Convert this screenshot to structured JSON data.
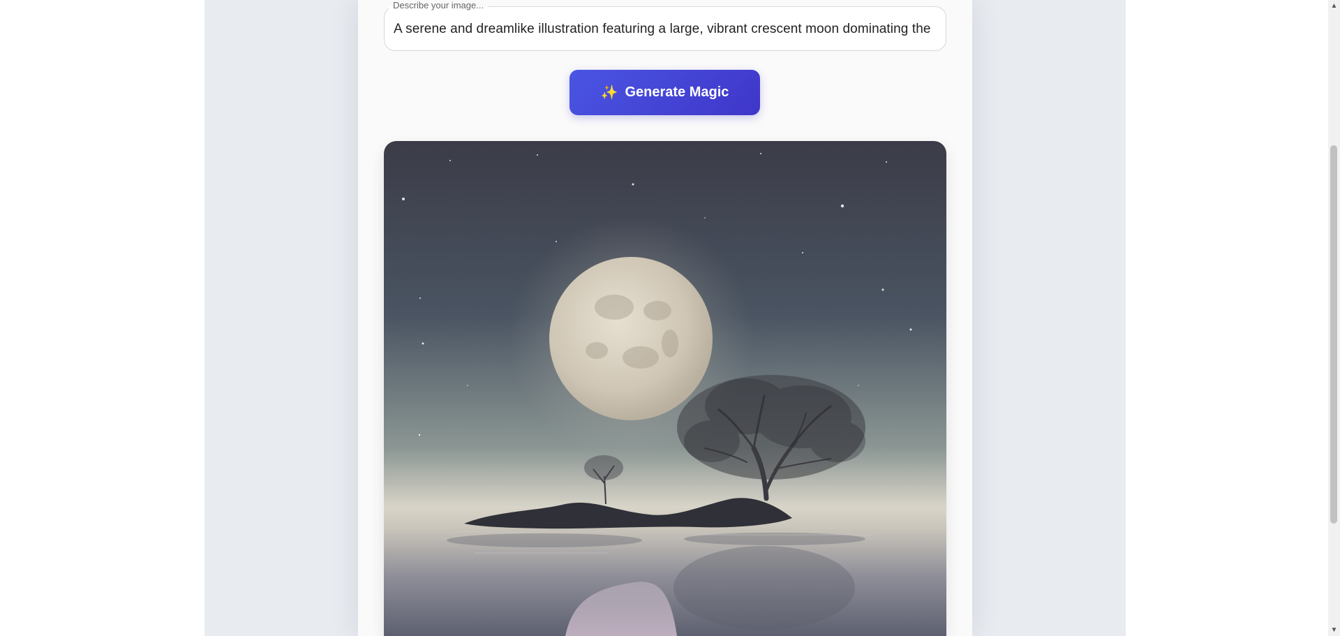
{
  "prompt": {
    "label": "Describe your image...",
    "value": "A serene and dreamlike illustration featuring a large, vibrant crescent moon dominating the"
  },
  "generate_button": {
    "icon": "sparkles-icon",
    "icon_glyph": "✨",
    "label": "Generate Magic"
  },
  "colors": {
    "button_start": "#4a55e3",
    "button_end": "#3f36c8",
    "page_bg": "#e8ebf0",
    "card_bg": "#fafafa"
  },
  "scrollbar": {
    "up_glyph": "▲",
    "down_glyph": "▼"
  }
}
